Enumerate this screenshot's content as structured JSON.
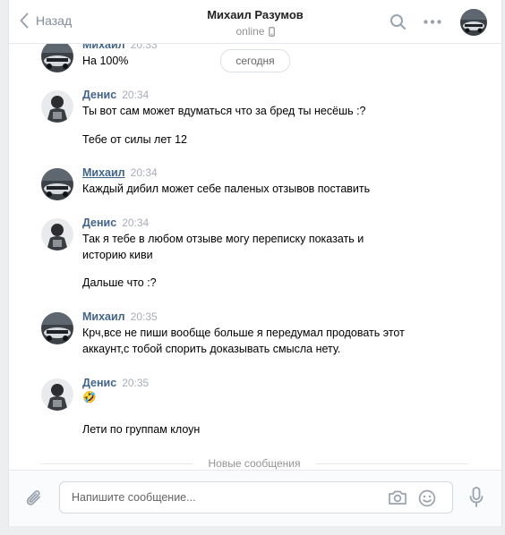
{
  "header": {
    "back_label": "Назад",
    "title": "Михаил Разумов",
    "status": "online"
  },
  "messages": {
    "day_label": "сегодня",
    "items": [
      {
        "author": "Михаил",
        "time": "20:33",
        "lines": [
          "На 100%"
        ]
      },
      {
        "author": "Денис",
        "time": "20:34",
        "lines": [
          "Ты вот сам может вдуматься что за бред ты несёшь :?",
          "Тебе от силы лет 12"
        ]
      },
      {
        "author": "Михаил",
        "time": "20:34",
        "lines": [
          "Каждый дибил может себе паленых отзывов поставить"
        ]
      },
      {
        "author": "Денис",
        "time": "20:34",
        "lines": [
          "Так я тебе в любом отзыве могу переписку показать и",
          "историю киви",
          "Дальше что :?"
        ]
      },
      {
        "author": "Михаил",
        "time": "20:35",
        "lines": [
          "Крч,все не пиши вообще больше я передумал продовать этот",
          "аккаунт,с тобой спорить доказывать смысла нету."
        ]
      },
      {
        "author": "Денис",
        "time": "20:35",
        "lines": [
          "🤣",
          "Лети по группам клоун"
        ]
      }
    ],
    "new_messages_label": "Новые сообщения"
  },
  "composer": {
    "placeholder": "Напишите сообщение..."
  },
  "icons": {
    "back": "chevron-left-icon",
    "search": "search-icon",
    "more": "more-dots-icon",
    "phone": "phone-icon",
    "attach": "paperclip-icon",
    "camera": "camera-icon",
    "smile": "smile-icon",
    "mic": "microphone-icon"
  },
  "colors": {
    "author_link": "#42648b",
    "time": "#a8adb7",
    "icon": "#99a2ad"
  }
}
